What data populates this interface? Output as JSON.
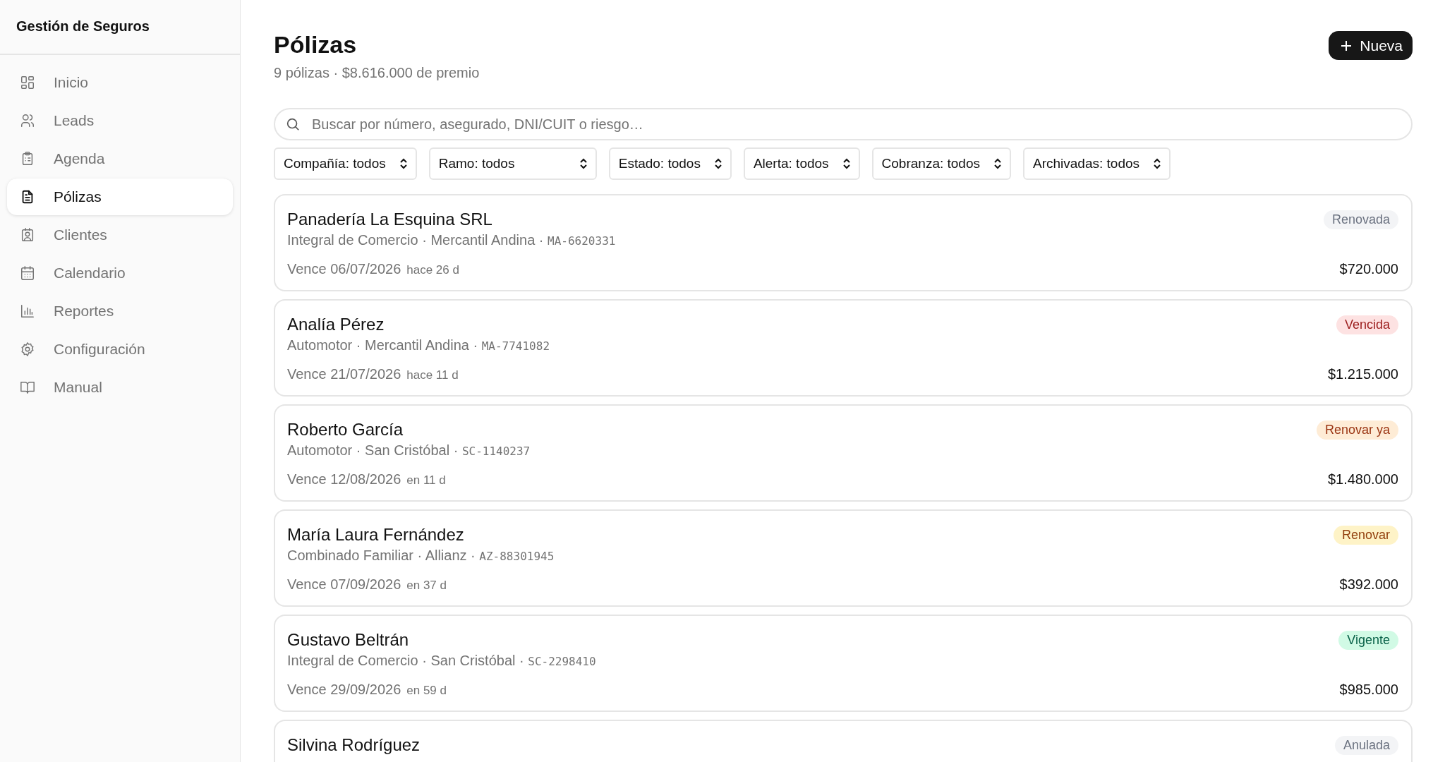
{
  "sidebar": {
    "title": "Gestión de Seguros",
    "items": [
      {
        "label": "Inicio",
        "selected": false
      },
      {
        "label": "Leads",
        "selected": false
      },
      {
        "label": "Agenda",
        "selected": false
      },
      {
        "label": "Pólizas",
        "selected": true
      },
      {
        "label": "Clientes",
        "selected": false
      },
      {
        "label": "Calendario",
        "selected": false
      },
      {
        "label": "Reportes",
        "selected": false
      },
      {
        "label": "Configuración",
        "selected": false
      },
      {
        "label": "Manual",
        "selected": false
      }
    ]
  },
  "header": {
    "title": "Pólizas",
    "subtitle": "9 pólizas · $8.616.000 de premio",
    "new_button": "Nueva"
  },
  "search": {
    "placeholder": "Buscar por número, asegurado, DNI/CUIT o riesgo…"
  },
  "filters": [
    "Compañía: todos",
    "Ramo: todos",
    "Estado: todos",
    "Alerta: todos",
    "Cobranza: todos",
    "Archivadas: todos"
  ],
  "policies": [
    {
      "name": "Panadería La Esquina SRL",
      "details": "Integral de Comercio · Mercantil Andina ·",
      "number": "MA-6620331",
      "expiry": "Vence 06/07/2026",
      "relative": "hace 26 d",
      "amount": "$720.000",
      "status": "Renovada",
      "kind": "renovada"
    },
    {
      "name": "Analía Pérez",
      "details": "Automotor · Mercantil Andina ·",
      "number": "MA-7741082",
      "expiry": "Vence 21/07/2026",
      "relative": "hace 11 d",
      "amount": "$1.215.000",
      "status": "Vencida",
      "kind": "vencida"
    },
    {
      "name": "Roberto García",
      "details": "Automotor · San Cristóbal ·",
      "number": "SC-1140237",
      "expiry": "Vence 12/08/2026",
      "relative": "en 11 d",
      "amount": "$1.480.000",
      "status": "Renovar ya",
      "kind": "urgente"
    },
    {
      "name": "María Laura Fernández",
      "details": "Combinado Familiar · Allianz ·",
      "number": "AZ-88301945",
      "expiry": "Vence 07/09/2026",
      "relative": "en 37 d",
      "amount": "$392.000",
      "status": "Renovar",
      "kind": "renovar"
    },
    {
      "name": "Gustavo Beltrán",
      "details": "Integral de Comercio · San Cristóbal ·",
      "number": "SC-2298410",
      "expiry": "Vence 29/09/2026",
      "relative": "en 59 d",
      "amount": "$985.000",
      "status": "Vigente",
      "kind": "vigente"
    },
    {
      "name": "Silvina Rodríguez",
      "status": "Anulada",
      "kind": "anulada"
    }
  ]
}
